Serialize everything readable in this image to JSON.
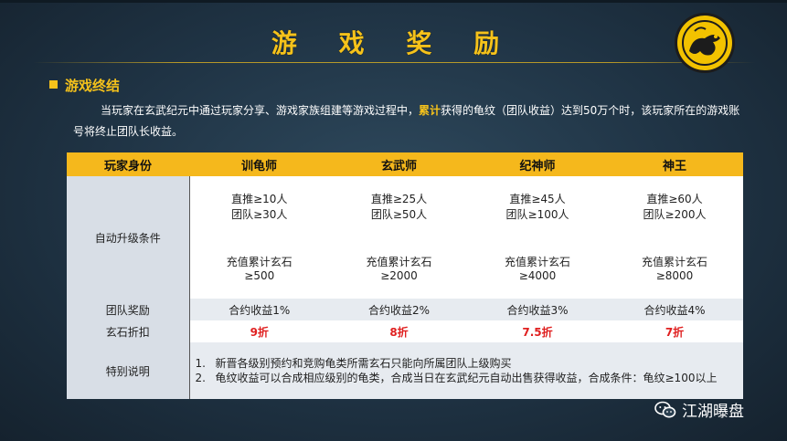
{
  "title": "游 戏 奖 励",
  "section": {
    "title": "游戏终结",
    "para_before": "当玩家在玄武纪元中通过玩家分享、游戏家族组建等游戏过程中，",
    "para_highlight": "累计",
    "para_after": "获得的龟纹（团队收益）达到50万个时，该玩家所在的游戏账号将终止团队长收益。"
  },
  "table": {
    "headers": [
      "玩家身份",
      "训龟师",
      "玄武师",
      "纪神师",
      "神王"
    ],
    "upgrade_label": "自动升级条件",
    "upgrade_refer": [
      {
        "l1": "直推≥10人",
        "l2": "团队≥30人"
      },
      {
        "l1": "直推≥25人",
        "l2": "团队≥50人"
      },
      {
        "l1": "直推≥45人",
        "l2": "团队≥100人"
      },
      {
        "l1": "直推≥60人",
        "l2": "团队≥200人"
      }
    ],
    "upgrade_recharge": [
      {
        "l1": "充值累计玄石",
        "l2": "≥500"
      },
      {
        "l1": "充值累计玄石",
        "l2": "≥2000"
      },
      {
        "l1": "充值累计玄石",
        "l2": "≥4000"
      },
      {
        "l1": "充值累计玄石",
        "l2": "≥8000"
      }
    ],
    "reward_label": "团队奖励",
    "rewards": [
      "合约收益1%",
      "合约收益2%",
      "合约收益3%",
      "合约收益4%"
    ],
    "discount_label": "玄石折扣",
    "discounts": [
      "9折",
      "8折",
      "7.5折",
      "7折"
    ],
    "note_label": "特别说明",
    "notes": [
      {
        "num": "1.",
        "text": "新晋各级别预约和竞购龟类所需玄石只能向所属团队上级购买"
      },
      {
        "num": "2.",
        "text": "龟纹收益可以合成相应级别的龟类，合成当日在玄武纪元自动出售获得收益，合成条件：龟纹≥100以上"
      }
    ]
  },
  "watermark": "江湖曝盘",
  "colors": {
    "accent": "#f5c21b",
    "header": "#f5b81c",
    "discount": "#e02020"
  },
  "icons": {
    "logo": "turtle-emblem-icon",
    "watermark": "wechat-icon"
  }
}
